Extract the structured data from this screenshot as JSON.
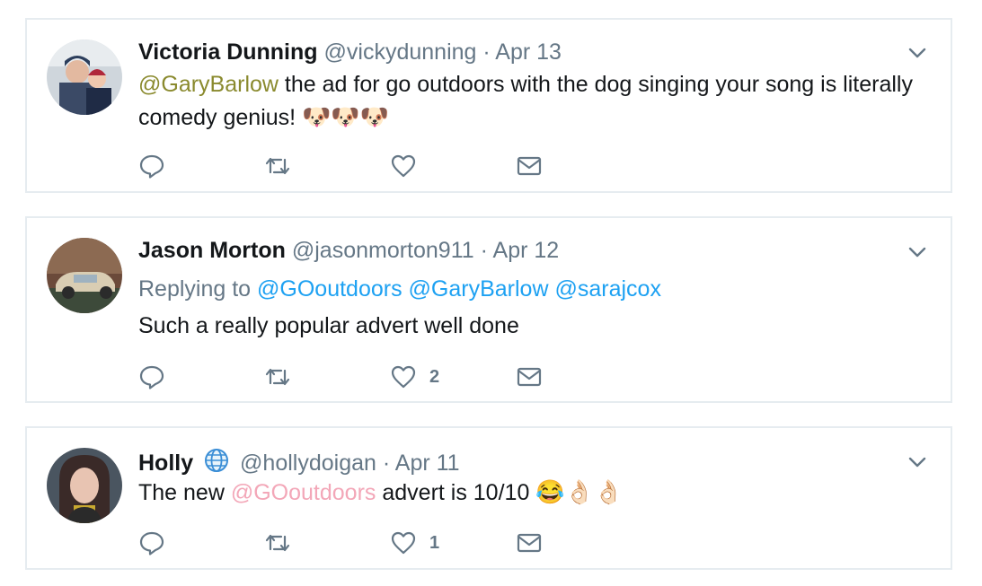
{
  "tweets": [
    {
      "name": "Victoria Dunning",
      "handle": "@vickydunning",
      "separator": "·",
      "date": "Apr 13",
      "mention": "@GaryBarlow",
      "text": " the ad for go outdoors with the dog singing your song is literally comedy genius! ",
      "emojis": "🐶🐶🐶",
      "like_count": ""
    },
    {
      "name": "Jason Morton",
      "handle": "@jasonmorton911",
      "separator": "·",
      "date": "Apr 12",
      "replying_label": "Replying to",
      "replying_to": [
        "@GOoutdoors",
        "@GaryBarlow",
        "@sarajcox"
      ],
      "text": "Such a really popular advert well done",
      "like_count": "2"
    },
    {
      "name": "Holly",
      "badge_icon": "globe-icon",
      "handle": "@hollydoigan",
      "separator": "·",
      "date": "Apr 11",
      "text_before": "The new ",
      "mention": "@GOoutdoors",
      "text_after": " advert is 10/10 ",
      "emojis": "😂👌🏻👌🏻",
      "like_count": "1"
    }
  ],
  "icons": {
    "reply": "reply-icon",
    "retweet": "retweet-icon",
    "like": "heart-icon",
    "dm": "envelope-icon",
    "more": "chevron-down-icon"
  },
  "colors": {
    "icon_gray": "#657786",
    "mention_blue": "#1da1f2",
    "mention_olive": "#8a8a2e",
    "mention_pink": "#f3a7b8",
    "border": "#e6ecf0"
  }
}
